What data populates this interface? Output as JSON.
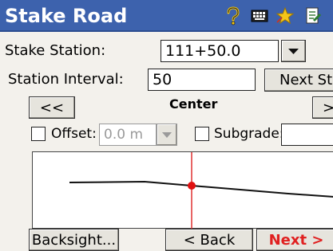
{
  "title": "Stake Road",
  "toolbar_icons": [
    "help-icon",
    "keyboard-icon",
    "favorites-star-icon",
    "document-icon"
  ],
  "stake_station": {
    "label": "Stake Station:",
    "value": "111+50.0"
  },
  "station_interval": {
    "label": "Station Interval:",
    "value": "50"
  },
  "next_station_button": "Next Sta",
  "prev_button": "<<",
  "next_small_button": ">",
  "center_label": "Center",
  "offset": {
    "label": "Offset:",
    "value": "0.0 m"
  },
  "subgrade": {
    "label": "Subgrade:"
  },
  "footer": {
    "backsight": "Backsight...",
    "back": "< Back",
    "next": "Next >"
  },
  "colors": {
    "titlebar": "#3d62ad",
    "alignment_line": "#111111",
    "station_line": "#e03030",
    "next_text": "#e02020"
  }
}
